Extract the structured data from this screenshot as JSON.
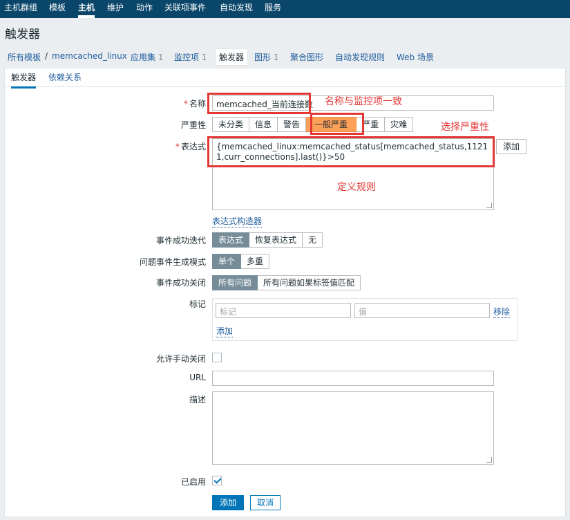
{
  "topnav": {
    "items": [
      "主机群组",
      "模板",
      "主机",
      "维护",
      "动作",
      "关联项事件",
      "自动发现",
      "服务"
    ]
  },
  "page": {
    "title": "触发器"
  },
  "breadcrumbs": {
    "all_templates": "所有模板",
    "separator": "/",
    "template": "memcached_linux",
    "apps": "应用集",
    "apps_count": "1",
    "items": "监控项",
    "items_count": "1",
    "triggers": "触发器",
    "graphs": "图形",
    "graphs_count": "1",
    "screens": "聚合图形",
    "discovery": "自动发现规则",
    "web": "Web 场景"
  },
  "subtabs": {
    "trigger": "触发器",
    "deps": "依赖关系"
  },
  "form": {
    "name_label": "名称",
    "name_value": "memcached_当前连接数",
    "severity_label": "严重性",
    "severity_options": [
      "未分类",
      "信息",
      "警告",
      "一般严重",
      "严重",
      "灾难"
    ],
    "severity_selected": "一般严重",
    "expression_label": "表达式",
    "expression_value": "{memcached_linux:memcached_status[memcached_status,11211,curr_connections].last()}>50",
    "add_button": "添加",
    "expression_builder": "表达式构造器",
    "ok_event_label": "事件成功迭代",
    "ok_event_options": [
      "表达式",
      "恢复表达式",
      "无"
    ],
    "problem_mode_label": "问题事件生成模式",
    "problem_mode_options": [
      "单个",
      "多重"
    ],
    "ok_close_label": "事件成功关闭",
    "ok_close_options": [
      "所有问题",
      "所有问题如果标签值匹配"
    ],
    "tags_label": "标记",
    "tag_placeholder": "标记",
    "value_placeholder": "值",
    "remove_link": "移除",
    "add_link": "添加",
    "manual_close_label": "允许手动关闭",
    "url_label": "URL",
    "description_label": "描述",
    "enabled_label": "已启用",
    "submit_button": "添加",
    "cancel_button": "取消"
  },
  "annotations": {
    "name_note": "名称与监控项一致",
    "severity_note": "选择严重性",
    "rule_note": "定义规则"
  },
  "colors": {
    "nav_bg": "#0a466a",
    "primary": "#0275b8",
    "severity_average": "#ffa059",
    "annotation_red": "#e33734"
  }
}
